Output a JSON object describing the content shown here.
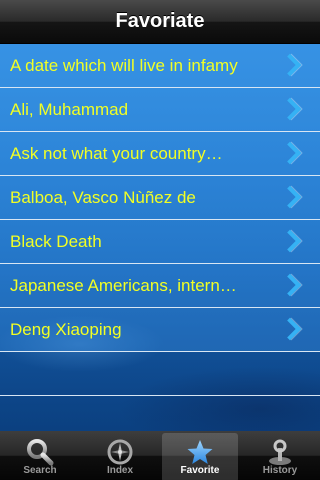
{
  "nav": {
    "title": "Favoriate"
  },
  "favorites": [
    {
      "label": "A date which will live in infamy"
    },
    {
      "label": "Ali, Muhammad"
    },
    {
      "label": "Ask not what your country…"
    },
    {
      "label": "Balboa, Vasco Nùñez de"
    },
    {
      "label": "Black Death"
    },
    {
      "label": "Japanese Americans, intern…"
    },
    {
      "label": "Deng Xiaoping"
    }
  ],
  "tabs": [
    {
      "label": "Search",
      "icon": "magnifier-icon",
      "selected": false
    },
    {
      "label": "Index",
      "icon": "compass-icon",
      "selected": false
    },
    {
      "label": "Favorite",
      "icon": "star-icon",
      "selected": true
    },
    {
      "label": "History",
      "icon": "joystick-icon",
      "selected": false
    }
  ],
  "colors": {
    "row_text": "#f2ff24",
    "chevron": "#35b2f4",
    "selected_tab_icon": "#4aa8f0"
  }
}
